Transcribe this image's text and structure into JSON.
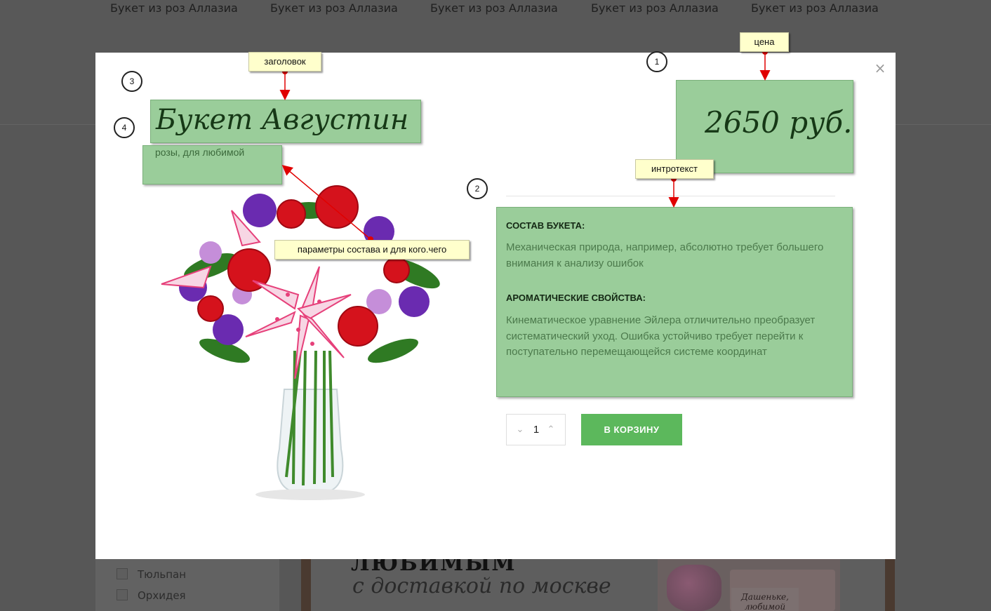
{
  "background": {
    "nav_items": [
      "Букет из роз Аллазиа",
      "Букет из роз Аллазиа",
      "Букет из роз Аллазиа",
      "Букет из роз Аллазиа",
      "Букет из роз Аллазиа"
    ],
    "sidebar_items": [
      "Тюльпан",
      "Орхидея"
    ],
    "banner_top": "ЛЮБИМЫМ",
    "banner_sub": "с доставкой по москве",
    "promo_card": "Дашеньке, любимой"
  },
  "modal": {
    "close_label": "×",
    "title": "Букет Августин",
    "subtitle": "розы, для любимой",
    "price": "2650 руб.",
    "sections": [
      {
        "heading": "СОСТАВ БУКЕТА:",
        "text": "Механическая природа, например, абсолютно требует большего внимания к анализу ошибок"
      },
      {
        "heading": "АРОМАТИЧЕСКИЕ СВОЙСТВА:",
        "text": "Кинематическое уравнение Эйлера отличительно преобразует систематический уход. Ошибка устойчиво требует перейти к поступательно перемещающейся системе координат"
      }
    ],
    "quantity": {
      "value": "1",
      "down_icon": "chevron-down-icon",
      "up_icon": "chevron-up-icon"
    },
    "cart_label": "В КОРЗИНУ"
  },
  "annotations": {
    "notes": {
      "title": "заголовок",
      "price": "цена",
      "intro": "интротекст",
      "params": "параметры состава и для кого.чего"
    },
    "markers": [
      "1",
      "2",
      "3",
      "4"
    ]
  },
  "colors": {
    "highlight": "#9acd9a",
    "button": "#5cb85c",
    "arrow": "#e00000",
    "note_bg": "#ffffcc"
  }
}
